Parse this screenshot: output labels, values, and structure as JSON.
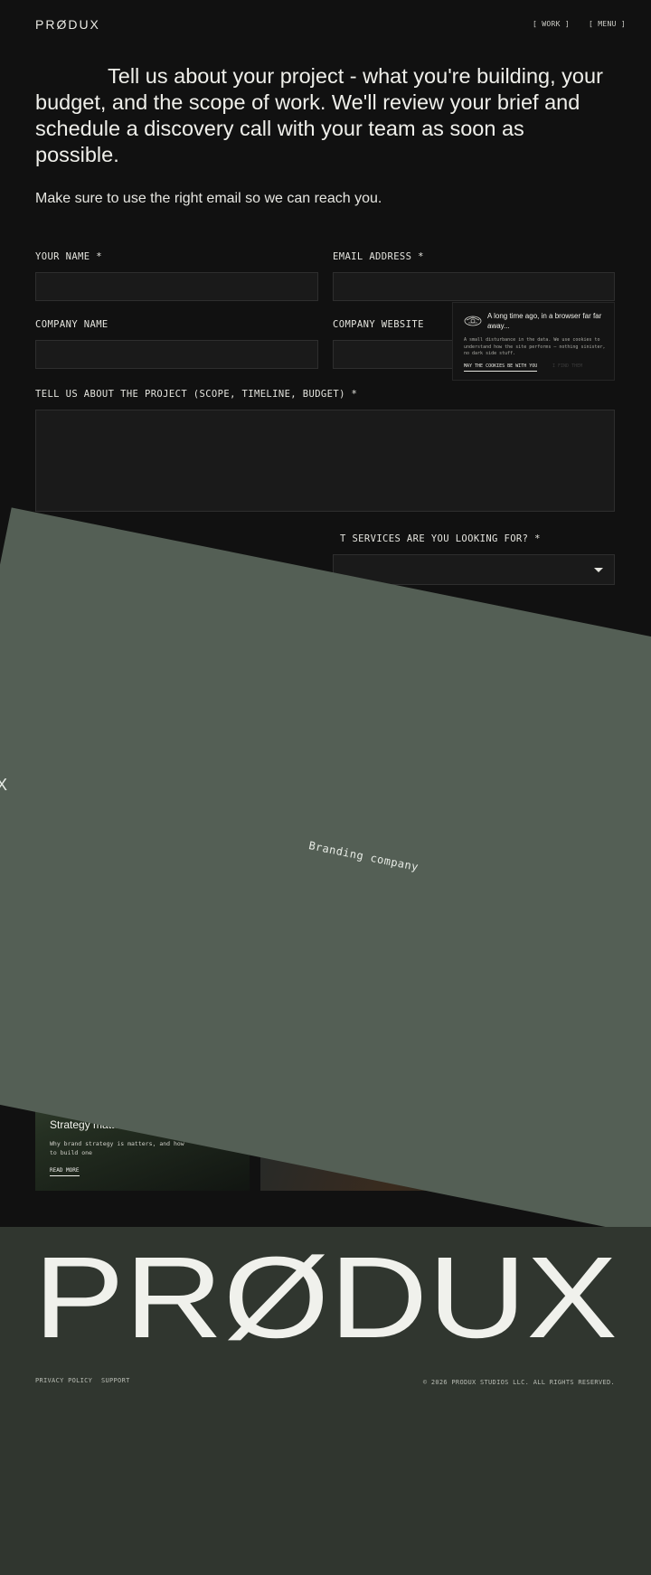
{
  "header": {
    "logo": "PRØDUX",
    "nav": {
      "work": "[ WORK ]",
      "menu": "[ MENU ]"
    }
  },
  "intro": {
    "text": "Tell us about your project - what you're building, your budget, and the scope of work. We'll review your brief and schedule a discovery call with your team as soon as possible.",
    "note": "Make sure to use the right email so we can reach you."
  },
  "form": {
    "name_label": "YOUR NAME *",
    "name_value": "",
    "email_label": "EMAIL ADDRESS *",
    "email_value": "",
    "company_label": "COMPANY NAME",
    "company_value": "",
    "website_label": "COMPANY WEBSITE",
    "website_value": "",
    "project_label": "TELL US ABOUT THE PROJECT (SCOPE, TIMELINE, BUDGET) *",
    "project_value": "",
    "services_label": "T SERVICES ARE YOU LOOKING FOR? *",
    "services_value": ""
  },
  "cookie": {
    "title": "A long time ago, in a browser far far away...",
    "body": "A small disturbance in the data. We use cookies to understand how the site performs — nothing sinister, no dark side stuff.",
    "accept": "MAY THE COOKIES BE WITH YOU",
    "decline": "I FIND THEM"
  },
  "overlay": {
    "label": "Branding company",
    "close_glyph": "X"
  },
  "cards": [
    {
      "title": "Strategy matters",
      "description": "Why brand strategy is matters, and how to build one",
      "cta": "READ MORE"
    }
  ],
  "footer": {
    "logo": "PRØDUX",
    "privacy": "PRIVACY POLICY",
    "support": "SUPPORT",
    "copyright": "© 2026 PRODUX STUDIOS LLC. ALL RIGHTS RESERVED."
  },
  "colors": {
    "background": "#111111",
    "overlay": "#545f55",
    "footer": "#30362f",
    "text": "#eeeeea"
  }
}
